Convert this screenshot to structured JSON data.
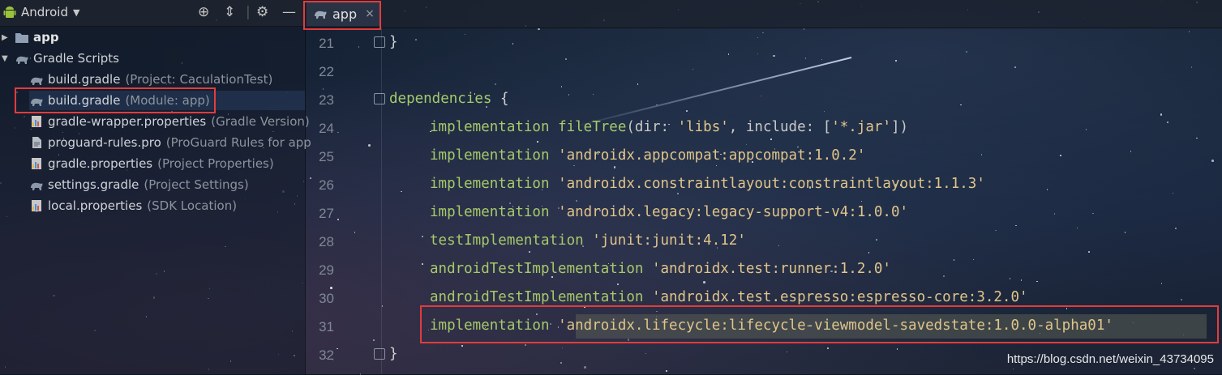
{
  "project_panel": {
    "view_label": "Android",
    "tree": [
      {
        "label": "app",
        "hint": "",
        "icon": "folder-icon"
      },
      {
        "label": "Gradle Scripts",
        "hint": "",
        "icon": "gradle-icon"
      },
      {
        "label": "build.gradle",
        "hint": "(Project: CaculationTest)",
        "icon": "gradle-icon"
      },
      {
        "label": "build.gradle",
        "hint": "(Module: app)",
        "icon": "gradle-icon"
      },
      {
        "label": "gradle-wrapper.properties",
        "hint": "(Gradle Version)",
        "icon": "properties-icon"
      },
      {
        "label": "proguard-rules.pro",
        "hint": "(ProGuard Rules for app",
        "icon": "file-icon"
      },
      {
        "label": "gradle.properties",
        "hint": "(Project Properties)",
        "icon": "properties-icon"
      },
      {
        "label": "settings.gradle",
        "hint": "(Project Settings)",
        "icon": "gradle-icon"
      },
      {
        "label": "local.properties",
        "hint": "(SDK Location)",
        "icon": "properties-icon"
      }
    ]
  },
  "editor": {
    "tab_label": "app",
    "tab_close": "×",
    "lines": [
      {
        "num": "21",
        "tokens": [
          {
            "t": "}",
            "c": "brace"
          }
        ]
      },
      {
        "num": "22",
        "tokens": []
      },
      {
        "num": "23",
        "tokens": [
          {
            "t": "dependencies",
            "c": "kw"
          },
          {
            "t": " {",
            "c": "brace"
          }
        ]
      },
      {
        "num": "24",
        "tokens": [
          {
            "t": "implementation",
            "c": "kw"
          },
          {
            "t": " ",
            "c": "plain"
          },
          {
            "t": "fileTree",
            "c": "kw"
          },
          {
            "t": "(dir: ",
            "c": "plain"
          },
          {
            "t": "'libs'",
            "c": "str"
          },
          {
            "t": ", include: [",
            "c": "plain"
          },
          {
            "t": "'*.jar'",
            "c": "str"
          },
          {
            "t": "])",
            "c": "plain"
          }
        ]
      },
      {
        "num": "25",
        "tokens": [
          {
            "t": "implementation",
            "c": "kw"
          },
          {
            "t": " ",
            "c": "plain"
          },
          {
            "t": "'androidx.appcompat:appcompat:1.0.2'",
            "c": "str"
          }
        ]
      },
      {
        "num": "26",
        "tokens": [
          {
            "t": "implementation",
            "c": "kw"
          },
          {
            "t": " ",
            "c": "plain"
          },
          {
            "t": "'androidx.constraintlayout:constraintlayout:1.1.3'",
            "c": "str"
          }
        ]
      },
      {
        "num": "27",
        "tokens": [
          {
            "t": "implementation",
            "c": "kw"
          },
          {
            "t": " ",
            "c": "plain"
          },
          {
            "t": "'androidx.legacy:legacy-support-v4:1.0.0'",
            "c": "str"
          }
        ]
      },
      {
        "num": "28",
        "tokens": [
          {
            "t": "testImplementation",
            "c": "kw"
          },
          {
            "t": " ",
            "c": "plain"
          },
          {
            "t": "'junit:junit:4.12'",
            "c": "str"
          }
        ]
      },
      {
        "num": "29",
        "tokens": [
          {
            "t": "androidTestImplementation",
            "c": "kw"
          },
          {
            "t": " ",
            "c": "plain"
          },
          {
            "t": "'androidx.test:runner:1.2.0'",
            "c": "str"
          }
        ]
      },
      {
        "num": "30",
        "tokens": [
          {
            "t": "androidTestImplementation",
            "c": "kw"
          },
          {
            "t": " ",
            "c": "plain"
          },
          {
            "t": "'androidx.test.espresso:espresso-core:3.2.0'",
            "c": "str"
          }
        ]
      },
      {
        "num": "31",
        "tokens": [
          {
            "t": "implementation",
            "c": "kw"
          },
          {
            "t": " ",
            "c": "plain"
          },
          {
            "t": "'androidx.lifecycle:lifecycle-viewmodel-savedstate:1.0.0-alpha01'",
            "c": "str"
          }
        ]
      },
      {
        "num": "32",
        "tokens": [
          {
            "t": "}",
            "c": "brace"
          }
        ]
      }
    ]
  },
  "watermark": "https://blog.csdn.net/weixin_43734095",
  "colors": {
    "keyword": "#a6c96a",
    "string": "#e0c58a",
    "highlight_box": "#e23c3c"
  }
}
